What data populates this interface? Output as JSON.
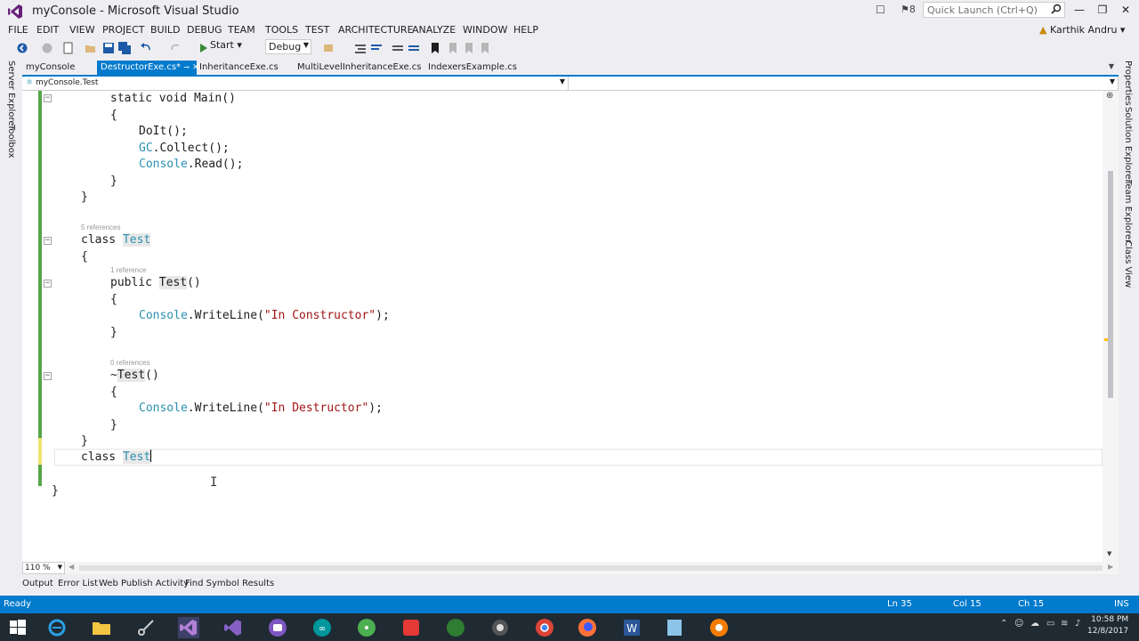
{
  "window": {
    "title": "myConsole - Microsoft Visual Studio",
    "notifications_count": "8",
    "quick_launch_placeholder": "Quick Launch (Ctrl+Q)",
    "user": "Karthik Andru"
  },
  "menu": [
    "FILE",
    "EDIT",
    "VIEW",
    "PROJECT",
    "BUILD",
    "DEBUG",
    "TEAM",
    "TOOLS",
    "TEST",
    "ARCHITECTURE",
    "ANALYZE",
    "WINDOW",
    "HELP"
  ],
  "toolbar": {
    "start_label": "Start",
    "config": "Debug"
  },
  "side_left": [
    "Server Explorer",
    "Toolbox"
  ],
  "side_right": [
    "Properties",
    "Solution Explorer",
    "Team Explorer",
    "Class View"
  ],
  "tabs": [
    {
      "label": "myConsole",
      "active": false
    },
    {
      "label": "DestructorExe.cs*",
      "active": true
    },
    {
      "label": "InheritanceExe.cs",
      "active": false
    },
    {
      "label": "MultiLevelInheritanceExe.cs",
      "active": false
    },
    {
      "label": "IndexersExample.cs",
      "active": false
    }
  ],
  "navbar": {
    "type_combo": "myConsole.Test",
    "member_combo": ""
  },
  "code": {
    "refs": {
      "class_test": "5 references",
      "ctor": "1 reference",
      "dtor": "0 references"
    },
    "lines": {
      "main_sig_kw1": "static",
      "main_sig_kw2": "void",
      "main_sig_name": "Main()",
      "brace_open": "{",
      "brace_close": "}",
      "doit": "DoIt();",
      "gc_type": "GC",
      "gc_call": ".Collect();",
      "console_type": "Console",
      "read_call": ".Read();",
      "class_kw": "class",
      "class_name": "Test",
      "public_kw": "public",
      "ctor_name": "Test",
      "parens": "()",
      "writeline_call": ".WriteLine(",
      "str_ctor": "\"In Constructor\"",
      "str_dtor": "\"In Destructor\"",
      "close_call": ");",
      "tilde": "~",
      "dtor_name": "Test"
    }
  },
  "zoom": "110 %",
  "tool_tabs": [
    "Output",
    "Error List",
    "Web Publish Activity",
    "Find Symbol Results"
  ],
  "status": {
    "state": "Ready",
    "ln": "Ln 35",
    "col": "Col 15",
    "ch": "Ch 15",
    "mode": "INS"
  },
  "clock": {
    "time": "10:58 PM",
    "date": "12/8/2017"
  },
  "colors": {
    "accent": "#007acc",
    "type": "#2b91af",
    "string": "#a31515",
    "changed_saved": "#57a64a",
    "changed_unsaved": "#efe36e"
  }
}
